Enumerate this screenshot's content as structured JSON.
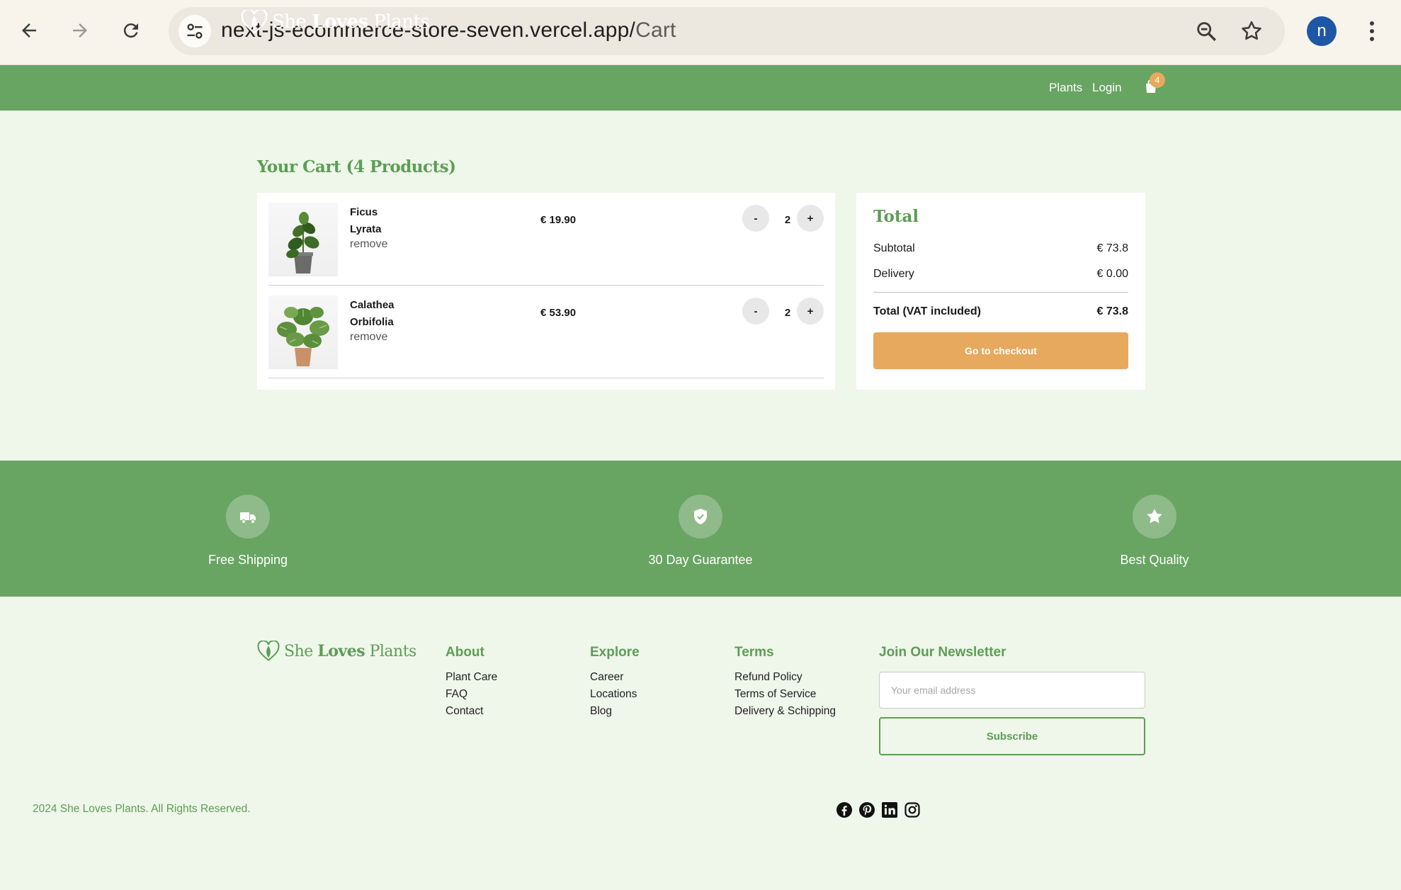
{
  "browser": {
    "url_host": "next-js-ecommerce-store-seven.vercel.app/",
    "url_path": "Cart",
    "profile_initial": "n"
  },
  "header": {
    "logo_she": "She",
    "logo_loves": "Loves",
    "logo_plants": "Plants",
    "nav": [
      "Plants",
      "Login"
    ],
    "cart_count": "4"
  },
  "cart": {
    "title": "Your Cart (4 Products)",
    "items": [
      {
        "name_line1": "Ficus",
        "name_line2": "Lyrata",
        "remove": "remove",
        "price": "€ 19.90",
        "qty": "2",
        "minus": "-",
        "plus": "+"
      },
      {
        "name_line1": "Calathea",
        "name_line2": "Orbifolia",
        "remove": "remove",
        "price": "€ 53.90",
        "qty": "2",
        "minus": "-",
        "plus": "+"
      }
    ]
  },
  "summary": {
    "title": "Total",
    "subtotal_label": "Subtotal",
    "subtotal_value": "€ 73.8",
    "delivery_label": "Delivery",
    "delivery_value": "€ 0.00",
    "total_label": "Total (VAT included)",
    "total_value": "€ 73.8",
    "checkout": "Go to checkout"
  },
  "features": [
    {
      "label": "Free Shipping",
      "icon": "truck-icon"
    },
    {
      "label": "30 Day Guarantee",
      "icon": "shield-check-icon"
    },
    {
      "label": "Best Quality",
      "icon": "star-icon"
    }
  ],
  "footer": {
    "about": {
      "title": "About",
      "links": [
        "Plant Care",
        "FAQ",
        "Contact"
      ]
    },
    "explore": {
      "title": "Explore",
      "links": [
        "Career",
        "Locations",
        "Blog"
      ]
    },
    "terms": {
      "title": "Terms",
      "links": [
        "Refund Policy",
        "Terms of Service",
        "Delivery & Schipping"
      ]
    },
    "newsletter": {
      "title": "Join Our Newsletter",
      "placeholder": "Your email address",
      "button": "Subscribe"
    },
    "copyright": "2024 She Loves Plants. All Rights Reserved.",
    "social": [
      "facebook-icon",
      "pinterest-icon",
      "linkedin-icon",
      "instagram-icon"
    ]
  },
  "colors": {
    "brand_green": "#68a462",
    "accent_orange": "#e7a95e",
    "page_bg": "#eff6ea"
  }
}
